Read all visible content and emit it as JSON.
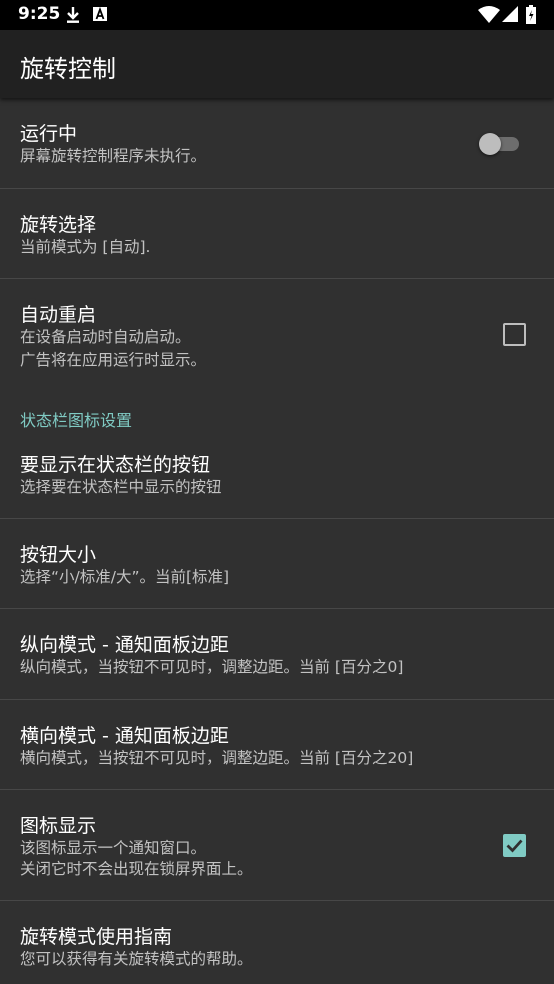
{
  "status_bar": {
    "time": "9:25",
    "icons": [
      "download-icon",
      "a-notification-icon",
      "wifi-icon",
      "signal-icon",
      "battery-icon"
    ]
  },
  "app_bar": {
    "title": "旋转控制"
  },
  "prefs": {
    "running": {
      "title": "运行中",
      "summary": "屏幕旋转控制程序未执行。",
      "switch_on": false
    },
    "rotation_select": {
      "title": "旋转选择",
      "summary": "当前模式为 [自动]."
    },
    "auto_restart": {
      "title": "自动重启",
      "summary_line1": "在设备启动时自动启动。",
      "summary_line2": "广告将在应用运行时显示。",
      "checked": false
    },
    "category_statusbar": "状态栏图标设置",
    "buttons_to_show": {
      "title": "要显示在状态栏的按钮",
      "summary": "选择要在状态栏中显示的按钮"
    },
    "button_size": {
      "title": "按钮大小",
      "summary": "选择“小/标准/大”。当前[标准]"
    },
    "portrait_margin": {
      "title": "纵向模式 - 通知面板边距",
      "summary": "纵向模式，当按钮不可见时，调整边距。当前 [百分之0]"
    },
    "landscape_margin": {
      "title": "横向模式 - 通知面板边距",
      "summary": "横向模式，当按钮不可见时，调整边距。当前 [百分之20]"
    },
    "icon_display": {
      "title": "图标显示",
      "summary_line1": "该图标显示一个通知窗口。",
      "summary_line2": "关闭它时不会出现在锁屏界面上。",
      "checked": true
    },
    "guide": {
      "title": "旋转模式使用指南",
      "summary": "您可以获得有关旋转模式的帮助。"
    }
  },
  "colors": {
    "background": "#303030",
    "app_bar": "#212121",
    "accent": "#80cbc4",
    "divider": "#474747"
  }
}
